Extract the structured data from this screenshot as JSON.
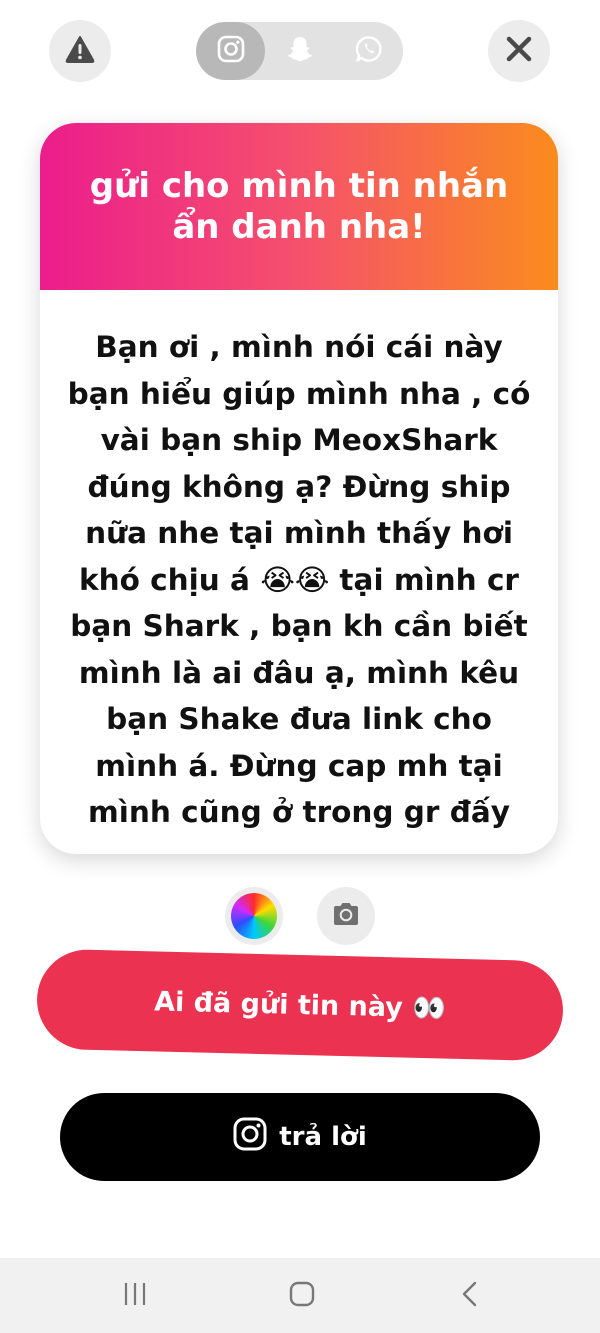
{
  "share": {
    "platforms": [
      "instagram",
      "snapchat",
      "whatsapp"
    ],
    "active": "instagram"
  },
  "card": {
    "title": "gửi cho mình tin nhắn ẩn danh nha!",
    "message": "Bạn ơi , mình nói cái này bạn hiểu giúp mình nha , có vài bạn ship MeoxShark đúng không ạ? Đừng ship nữa nhe tại mình thấy hơi khó chịu á 😭😭 tại mình cr bạn Shark , bạn kh cần biết mình là ai đâu ạ, mình kêu bạn Shake đưa link cho mình á. Đừng cap mh tại mình cũng ở trong gr đấy"
  },
  "buttons": {
    "who_sent": "Ai đã gửi tin này 👀",
    "reply": "trả lời"
  },
  "colors": {
    "gradient_start": "#ec1d8c",
    "gradient_end": "#fa8c1d",
    "who_button": "#ec3251",
    "reply_button": "#000000"
  },
  "icons": {
    "top_left": "warning-icon",
    "top_right": "close-icon",
    "tools": [
      "color-wheel-icon",
      "camera-icon"
    ],
    "nav": [
      "recent-apps-icon",
      "home-icon",
      "back-icon"
    ]
  }
}
